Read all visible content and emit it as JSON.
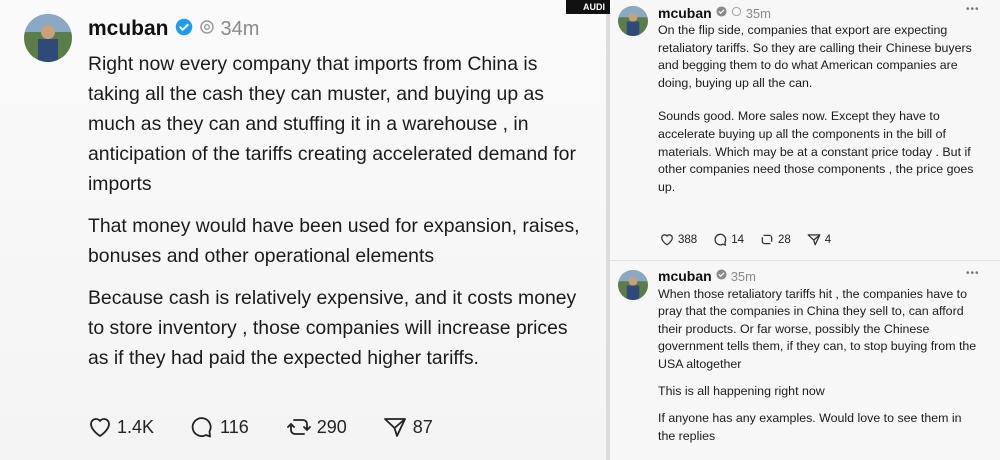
{
  "left_post": {
    "username": "mcuban",
    "time": "34m",
    "paragraphs": [
      "Right now every company that imports  from  China is taking all the cash they can muster, and buying up as much as they can and stuffing it in a warehouse , in anticipation of the tariffs creating accelerated demand for imports",
      "That money would have been used for expansion, raises, bonuses and other operational elements",
      "Because cash is relatively expensive,  and it costs money to store inventory ,  those companies will increase prices as if they had paid the expected higher tariffs."
    ],
    "likes": "1.4K",
    "replies": "116",
    "reposts": "290",
    "shares": "87"
  },
  "right_post_1": {
    "username": "mcuban",
    "time": "35m",
    "more": "•••",
    "paragraphs": [
      "On the flip side, companies that export are expecting retaliatory tariffs.  So they are calling their Chinese buyers and begging them to do what American companies are doing, buying up all the can.",
      "Sounds good. More sales now.  Except they have to accelerate buying up  all the components in the bill of materials.  Which may be at a constant price today . But if other companies need those components , the price goes up."
    ],
    "likes": "388",
    "replies": "14",
    "reposts": "28",
    "shares": "4"
  },
  "right_post_2": {
    "username": "mcuban",
    "time": "35m",
    "more": "•••",
    "paragraphs": [
      "When those retaliatory tariffs hit , the companies have to pray that the companies in China they sell to,  can afford their products.  Or far worse, possibly the Chinese government tells them, if they can,  to stop buying from the USA altogether",
      "This is all happening right now",
      "If anyone has any examples. Would love to see them in the replies"
    ]
  },
  "badge": {
    "text": "AUDI"
  },
  "colors": {
    "verified": "#1d9bf0",
    "text": "#1b1b1b",
    "muted": "#8a8a8a"
  }
}
